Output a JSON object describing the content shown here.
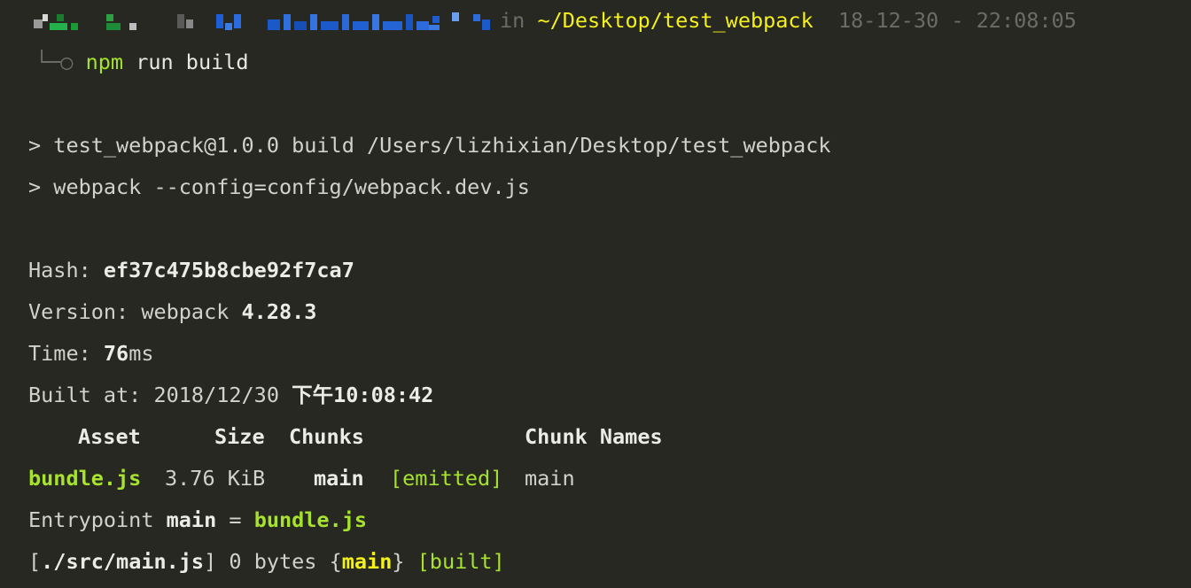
{
  "prompt": {
    "in_label": "in",
    "path": "~/Desktop/test_webpack",
    "timestamp": "18-12-30 - 22:08:05",
    "arrow": "└─○",
    "cmd_npm": "npm",
    "cmd_rest": " run build"
  },
  "script_lines": [
    "> test_webpack@1.0.0 build /Users/lizhixian/Desktop/test_webpack",
    "> webpack --config=config/webpack.dev.js"
  ],
  "stats": {
    "hash_label": "Hash: ",
    "hash_value": "ef37c475b8cbe92f7ca7",
    "version_label": "Version: webpack ",
    "version_value": "4.28.3",
    "time_label": "Time: ",
    "time_value": "76",
    "time_unit": "ms",
    "built_label": "Built at: 2018/12/30 ",
    "built_value": "下午10:08:42"
  },
  "table": {
    "headers": {
      "asset": "Asset",
      "size": "Size",
      "chunks": "Chunks",
      "chunk_names": "Chunk Names"
    },
    "row": {
      "asset": "bundle.js",
      "size": "3.76 KiB",
      "chunks": "main",
      "flag": "[emitted]",
      "chunk_names": "main"
    }
  },
  "entrypoint": {
    "label": "Entrypoint ",
    "name": "main",
    "eq": " = ",
    "file": "bundle.js"
  },
  "module": {
    "path": "[./src/main.js]",
    "size": " 0 bytes ",
    "open": "{",
    "chunk": "main",
    "close": "}",
    "flag": "[built]"
  },
  "colors": {
    "background": "#272822",
    "text": "#d2d2cc",
    "green": "#a6e22e",
    "yellow": "#f4f01a",
    "dim": "#6c6c64"
  }
}
